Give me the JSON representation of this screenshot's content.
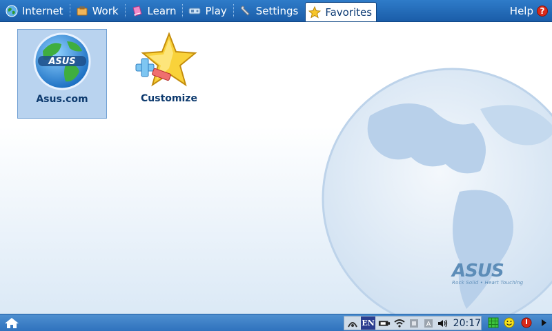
{
  "tabs": [
    {
      "label": "Internet",
      "icon": "globe-icon"
    },
    {
      "label": "Work",
      "icon": "briefcase-icon"
    },
    {
      "label": "Learn",
      "icon": "book-icon"
    },
    {
      "label": "Play",
      "icon": "gamepad-icon"
    },
    {
      "label": "Settings",
      "icon": "wrench-icon"
    },
    {
      "label": "Favorites",
      "icon": "star-icon",
      "active": true
    }
  ],
  "help": {
    "label": "Help",
    "glyph": "?"
  },
  "apps": [
    {
      "label": "Asus.com",
      "icon": "asus-globe-icon",
      "selected": true
    },
    {
      "label": "Customize",
      "icon": "customize-star-icon"
    }
  ],
  "watermark": {
    "logo": "ASUS",
    "tagline": "Rock Solid • Heart Touching"
  },
  "taskbar": {
    "language": "EN",
    "clock": "20:17",
    "tray_icons": [
      "network-icon",
      "language-icon",
      "battery-icon",
      "wifi-icon",
      "memory-icon",
      "keyboard-icon",
      "volume-icon"
    ],
    "right_icons": [
      "grid-icon",
      "smiley-icon",
      "power-icon",
      "arrow-right-icon"
    ]
  },
  "colors": {
    "tabbar": "#1a5da8",
    "accent": "#0d3a6e",
    "selected": "#b9d3ef"
  }
}
